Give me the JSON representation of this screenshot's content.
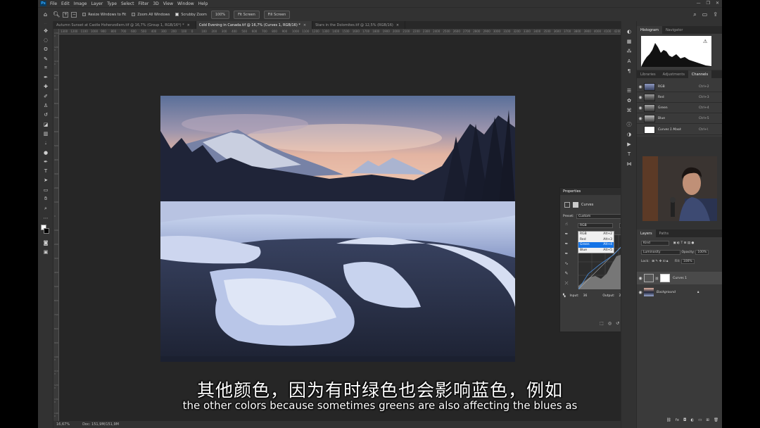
{
  "app": {
    "logo": "Ps"
  },
  "menu": [
    "File",
    "Edit",
    "Image",
    "Layer",
    "Type",
    "Select",
    "Filter",
    "3D",
    "View",
    "Window",
    "Help"
  ],
  "window_controls": [
    "—",
    "❐",
    "✕"
  ],
  "options": {
    "resize_windows": "Resize Windows to Fit",
    "zoom_all": "Zoom All Windows",
    "scrubby_zoom": "Scrubby Zoom",
    "zoom_value": "100%",
    "fit_screen_1": "Fit Screen",
    "fit_screen_2": "Fill Screen"
  },
  "tabs": [
    {
      "label": "Autumn Sunset at Castle Hohenzollern.tif @ 16,7% (Group 1, RGB/16*) *"
    },
    {
      "label": "Cold Evening in Canada.tif @ 16,7% (Curves 1, RGB/16) *"
    },
    {
      "label": "Stars in the Dolomites.tif @ 12,5% (RGB/16)"
    }
  ],
  "ruler_top": [
    "1300",
    "1200",
    "1100",
    "1000",
    "900",
    "800",
    "700",
    "600",
    "500",
    "400",
    "300",
    "200",
    "100",
    "0",
    "100",
    "200",
    "300",
    "400",
    "500",
    "600",
    "700",
    "800",
    "900",
    "1000",
    "1100",
    "1200",
    "1300",
    "1400",
    "1500",
    "1600",
    "1700",
    "1800",
    "1900",
    "2000",
    "2100",
    "2200",
    "2300",
    "2400",
    "2500",
    "2600",
    "2700",
    "2800",
    "2900",
    "3000",
    "3100",
    "3200",
    "3300",
    "3400",
    "3500",
    "3600",
    "3700",
    "3800",
    "3900",
    "4000",
    "4100",
    "4200"
  ],
  "status": {
    "zoom": "16,67%",
    "doc": "Doc: 151,9M/151,9M"
  },
  "right_tabs_top": [
    "Histogram",
    "Navigator"
  ],
  "right_tabs_mid": [
    "Libraries",
    "Adjustments",
    "Channels"
  ],
  "channels": [
    {
      "name": "RGB",
      "key": "Ctrl+2"
    },
    {
      "name": "Red",
      "key": "Ctrl+3"
    },
    {
      "name": "Green",
      "key": "Ctrl+4"
    },
    {
      "name": "Blue",
      "key": "Ctrl+5"
    },
    {
      "name": "Curves 1 Mask",
      "key": "Ctrl+\\"
    }
  ],
  "layers_tabs": [
    "Layers",
    "Paths"
  ],
  "layers_ctrl": {
    "kind": "Kind",
    "blend": "Luminosity",
    "opacity_label": "Opacity:",
    "opacity": "100%",
    "lock_label": "Lock:",
    "fill_label": "Fill:",
    "fill": "100%"
  },
  "layers": [
    {
      "name": "Curves 1"
    },
    {
      "name": "Background"
    }
  ],
  "properties": {
    "title": "Properties",
    "adj_name": "Curves",
    "preset_label": "Preset:",
    "preset_value": "Custom",
    "channel_value": "RGB",
    "auto": "Auto",
    "input_label": "Input:",
    "input_value": "36",
    "output_label": "Output:",
    "output_value": "201",
    "dropdown": [
      {
        "name": "RGB",
        "key": "Alt+2"
      },
      {
        "name": "Red",
        "key": "Alt+3"
      },
      {
        "name": "Green",
        "key": "Alt+4"
      },
      {
        "name": "Blue",
        "key": "Alt+5"
      }
    ]
  },
  "subtitles": {
    "chinese": "其他颜色，因为有时绿色也会影响蓝色，例如",
    "english": "the other colors because sometimes greens are also affecting the blues as"
  }
}
